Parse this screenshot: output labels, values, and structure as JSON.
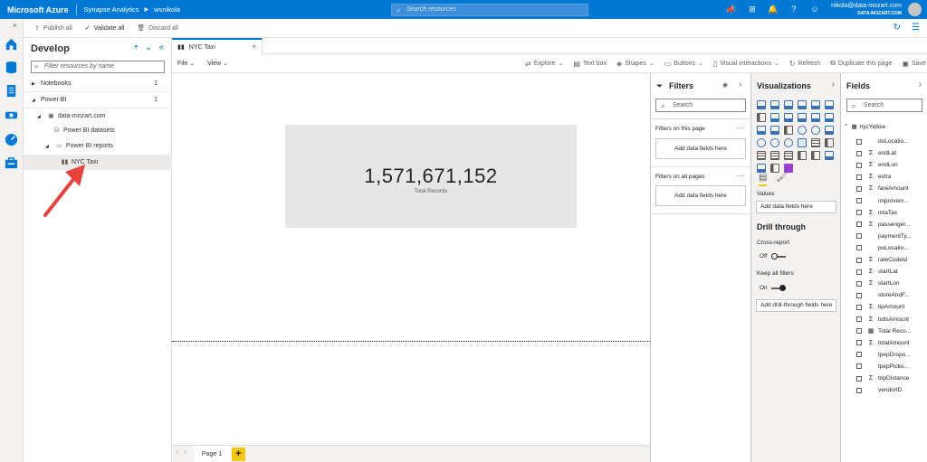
{
  "topbar": {
    "brand": "Microsoft Azure",
    "breadcrumb": [
      "Synapse Analytics",
      "wsnikola"
    ],
    "search_placeholder": "Search resources",
    "user_email": "nikola@data-mozart.com",
    "user_org": "DATA-MOZART.COM"
  },
  "commands": {
    "publish_all": "Publish all",
    "validate_all": "Validate all",
    "discard_all": "Discard all"
  },
  "develop": {
    "title": "Develop",
    "filter_placeholder": "Filter resources by name",
    "notebooks": "Notebooks",
    "notebooks_count": "1",
    "powerbi": "Power BI",
    "powerbi_count": "1",
    "workspace": "data-mozart.com",
    "datasets": "Power BI datasets",
    "reports": "Power BI reports",
    "report_item": "NYC Taxi"
  },
  "document_tab": {
    "title": "NYC Taxi"
  },
  "report_toolbar": {
    "file": "File",
    "view": "View",
    "explore": "Explore",
    "text_box": "Text box",
    "shapes": "Shapes",
    "buttons": "Buttons",
    "visual_interactions": "Visual interactions",
    "refresh": "Refresh",
    "duplicate_page": "Duplicate this page",
    "save": "Save"
  },
  "card": {
    "value": "1,571,671,152",
    "label": "Total Records"
  },
  "pages": {
    "page1": "Page 1",
    "add": "+"
  },
  "filters": {
    "title": "Filters",
    "search": "Search",
    "on_this_page": "Filters on this page",
    "on_all_pages": "Filters on all pages",
    "add_fields": "Add data fields here"
  },
  "visualizations": {
    "title": "Visualizations",
    "values_label": "Values",
    "add_fields": "Add data fields here",
    "drill_through": "Drill through",
    "cross_report": "Cross-report",
    "cross_report_state": "Off",
    "keep_all_filters": "Keep all filters",
    "keep_all_filters_state": "On",
    "add_drill": "Add drill-through fields here"
  },
  "fields": {
    "title": "Fields",
    "search": "Search",
    "table": "nycYellow",
    "items": [
      {
        "name": "doLocatio...",
        "sigma": false
      },
      {
        "name": "endLat",
        "sigma": true
      },
      {
        "name": "endLon",
        "sigma": true
      },
      {
        "name": "extra",
        "sigma": true
      },
      {
        "name": "fareAmount",
        "sigma": true
      },
      {
        "name": "improvem...",
        "sigma": false
      },
      {
        "name": "mtaTax",
        "sigma": true
      },
      {
        "name": "passenger...",
        "sigma": true
      },
      {
        "name": "paymentTy...",
        "sigma": false
      },
      {
        "name": "puLocatio...",
        "sigma": false
      },
      {
        "name": "rateCodeId",
        "sigma": true
      },
      {
        "name": "startLat",
        "sigma": true
      },
      {
        "name": "startLon",
        "sigma": true
      },
      {
        "name": "storeAndF...",
        "sigma": false
      },
      {
        "name": "tipAmount",
        "sigma": true
      },
      {
        "name": "tollsAmount",
        "sigma": true
      },
      {
        "name": "Total Reco...",
        "sigma": false,
        "measure": true
      },
      {
        "name": "totalAmount",
        "sigma": true
      },
      {
        "name": "tpepDropo...",
        "sigma": false
      },
      {
        "name": "tpepPicku...",
        "sigma": false
      },
      {
        "name": "tripDistance",
        "sigma": true
      },
      {
        "name": "vendorID",
        "sigma": false
      }
    ]
  },
  "colors": {
    "azure_blue": "#0078d4",
    "powerbi_yellow": "#f2c811",
    "arrow_red": "#e8423f"
  }
}
